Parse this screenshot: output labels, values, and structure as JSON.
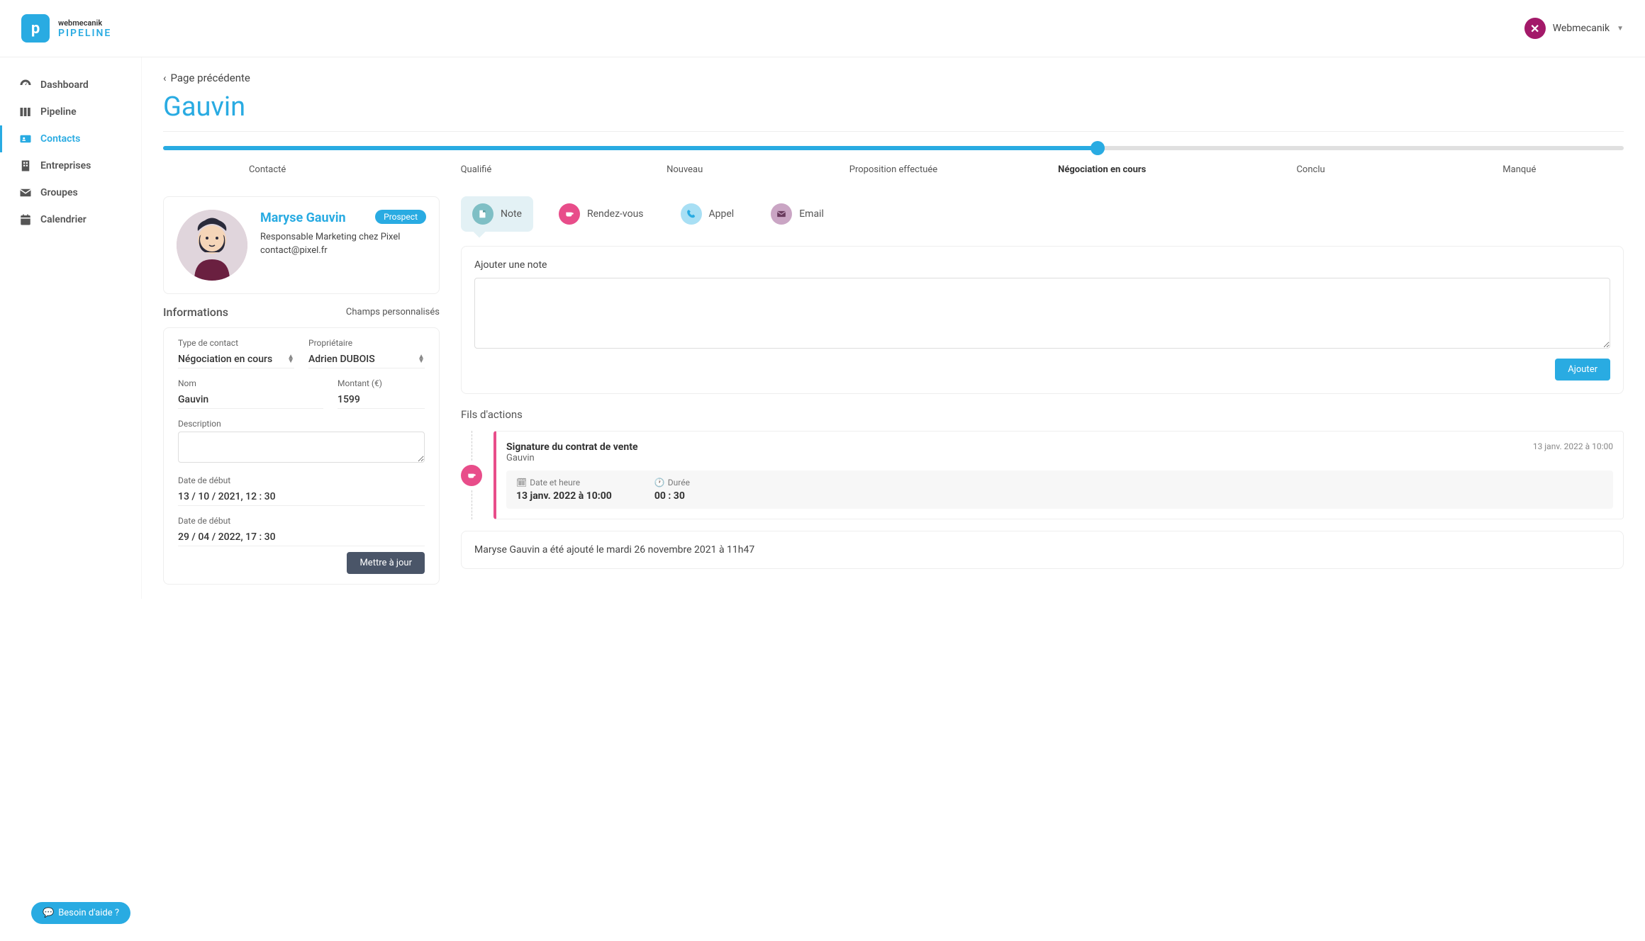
{
  "header": {
    "brand": "webmecanik",
    "product": "PIPELINE",
    "logo_letter": "p",
    "user_name": "Webmecanik",
    "user_initial": "✕"
  },
  "sidebar": {
    "items": [
      {
        "label": "Dashboard",
        "icon": "dashboard"
      },
      {
        "label": "Pipeline",
        "icon": "columns"
      },
      {
        "label": "Contacts",
        "icon": "id-card",
        "active": true
      },
      {
        "label": "Entreprises",
        "icon": "building"
      },
      {
        "label": "Groupes",
        "icon": "envelope"
      },
      {
        "label": "Calendrier",
        "icon": "calendar"
      }
    ]
  },
  "back_link": "Page précédente",
  "page_title": "Gauvin",
  "pipeline_stages": [
    {
      "label": "Contacté"
    },
    {
      "label": "Qualifié"
    },
    {
      "label": "Nouveau"
    },
    {
      "label": "Proposition effectuée"
    },
    {
      "label": "Négociation en cours",
      "active": true
    },
    {
      "label": "Conclu"
    },
    {
      "label": "Manqué"
    }
  ],
  "pipeline_percent": 64,
  "contact": {
    "name": "Maryse Gauvin",
    "role": "Responsable Marketing chez Pixel",
    "email": "contact@pixel.fr",
    "badge": "Prospect"
  },
  "info": {
    "section_title": "Informations",
    "custom_fields_link": "Champs personnalisés",
    "type_label": "Type de contact",
    "type_value": "Négociation en cours",
    "owner_label": "Propriétaire",
    "owner_value": "Adrien DUBOIS",
    "name_label": "Nom",
    "name_value": "Gauvin",
    "amount_label": "Montant (€)",
    "amount_value": "1599",
    "desc_label": "Description",
    "desc_value": "",
    "date1_label": "Date de début",
    "date1_value": "13 / 10 / 2021,  12 : 30",
    "date2_label": "Date de début",
    "date2_value": "29 / 04 / 2022,  17 : 30",
    "update_btn": "Mettre à jour"
  },
  "action_tabs": {
    "note": "Note",
    "rdv": "Rendez-vous",
    "call": "Appel",
    "mail": "Email"
  },
  "note_panel": {
    "title": "Ajouter une note",
    "add_btn": "Ajouter"
  },
  "timeline": {
    "title": "Fils d'actions",
    "items": [
      {
        "title": "Signature du contrat de vente",
        "subtitle": "Gauvin",
        "date": "13 janv. 2022 à 10:00",
        "dt_label": "Date et heure",
        "dt_value": "13 janv. 2022 à 10:00",
        "dur_label": "Durée",
        "dur_value": "00 : 30"
      }
    ],
    "created_note": "Maryse Gauvin a été ajouté le mardi 26 novembre 2021 à 11h47"
  },
  "help_btn": "Besoin d'aide ?"
}
